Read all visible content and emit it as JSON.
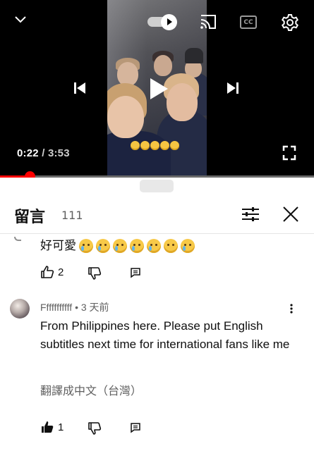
{
  "player": {
    "current_time": "0:22",
    "separator": " / ",
    "duration": "3:53",
    "progress_fraction": 0.095,
    "cc_label": "CC",
    "autoplay_on": true
  },
  "comments_panel": {
    "title": "留言",
    "count": "111"
  },
  "reply_stub": {
    "text": "好可愛",
    "emojis": [
      "crying-face",
      "crying-face",
      "crying-face",
      "crying-face",
      "crying-face",
      "pleading-face",
      "loudly-crying-face"
    ],
    "like_count": "2",
    "liked": false
  },
  "comment": {
    "author": "Fffffffffff",
    "dot": "•",
    "time": "3 天前",
    "text": "From Philippines here. Please put English subtitles next time for international fans like me",
    "translate_label": "翻譯成中文（台灣）",
    "like_count": "1",
    "liked": true
  },
  "colors": {
    "progress": "#ff0000",
    "text_primary": "#0f0f0f",
    "text_secondary": "#606060"
  }
}
